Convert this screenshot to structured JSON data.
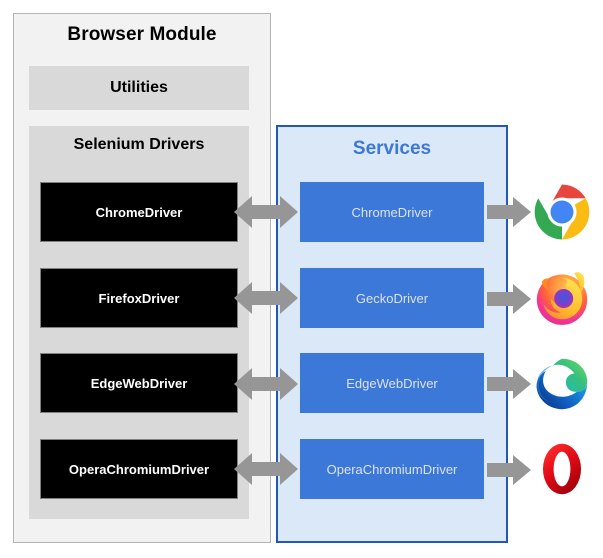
{
  "diagram": {
    "browser_module": {
      "title": "Browser Module",
      "utilities_label": "Utilities",
      "selenium_drivers_label": "Selenium Drivers",
      "drivers": [
        {
          "label": "ChromeDriver"
        },
        {
          "label": "FirefoxDriver"
        },
        {
          "label": "EdgeWebDriver"
        },
        {
          "label": "OperaChromiumDriver"
        }
      ]
    },
    "services": {
      "title": "Services",
      "items": [
        {
          "label": "ChromeDriver"
        },
        {
          "label": "GeckoDriver"
        },
        {
          "label": "EdgeWebDriver"
        },
        {
          "label": "OperaChromiumDriver"
        }
      ]
    },
    "browsers": [
      {
        "icon": "chrome-logo-icon",
        "name": "Chrome"
      },
      {
        "icon": "firefox-logo-icon",
        "name": "Firefox"
      },
      {
        "icon": "edge-logo-icon",
        "name": "Edge"
      },
      {
        "icon": "opera-logo-icon",
        "name": "Opera"
      }
    ],
    "connectors": {
      "driver_to_service": "bidirectional-arrow-icon",
      "service_to_browser": "right-arrow-icon"
    },
    "colors": {
      "module_background": "#f2f2f2",
      "module_border": "#b3b3b3",
      "subpanel_background": "#d9d9d9",
      "driver_box": "#000000",
      "driver_text": "#ffffff",
      "services_background": "#dbe8f7",
      "services_border": "#2159b8",
      "services_title": "#3c78d8",
      "service_box": "#3c78d8",
      "service_text": "#dbe2ed",
      "arrow": "#969696"
    }
  }
}
